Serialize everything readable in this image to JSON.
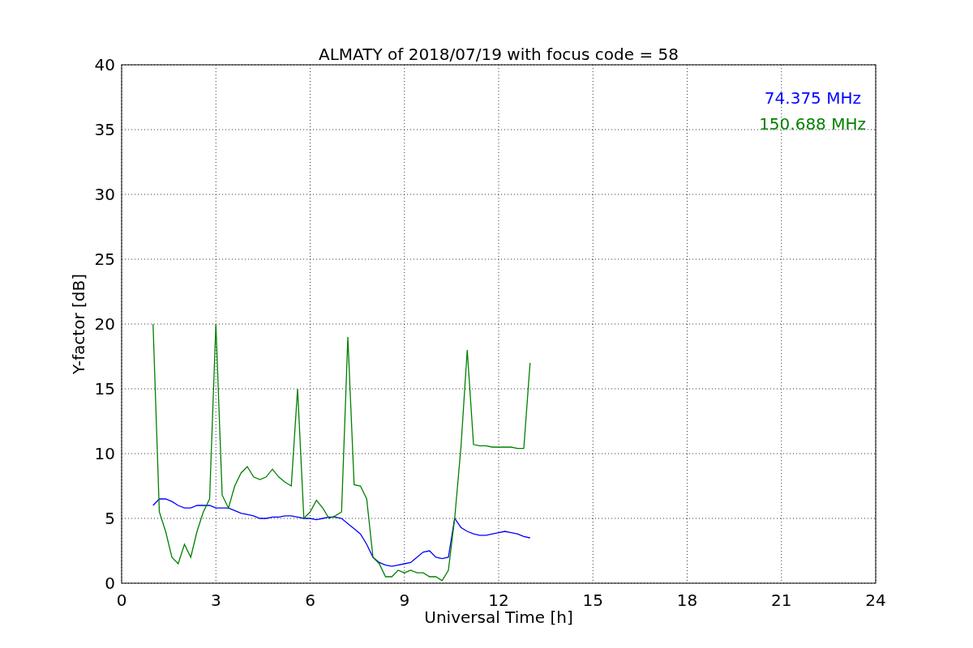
{
  "chart": {
    "chart_data": {
      "type": "line",
      "title": "ALMATY of 2018/07/19 with focus code = 58",
      "xlabel": "Universal Time [h]",
      "ylabel": "Y-factor [dB]",
      "x": [
        1.0,
        1.2,
        1.4,
        1.6,
        1.8,
        2.0,
        2.2,
        2.4,
        2.6,
        2.8,
        3.0,
        3.2,
        3.4,
        3.6,
        3.8,
        4.0,
        4.2,
        4.4,
        4.6,
        4.8,
        5.0,
        5.2,
        5.4,
        5.6,
        5.8,
        6.0,
        6.2,
        6.4,
        6.6,
        6.8,
        7.0,
        7.2,
        7.4,
        7.6,
        7.8,
        8.0,
        8.2,
        8.4,
        8.6,
        8.8,
        9.0,
        9.2,
        9.4,
        9.6,
        9.8,
        10.0,
        10.2,
        10.4,
        10.6,
        10.8,
        11.0,
        11.2,
        11.4,
        11.6,
        11.8,
        12.0,
        12.2,
        12.4,
        12.6,
        12.8,
        13.0
      ],
      "series": [
        {
          "name": "74.375 MHz",
          "color": "#0000ff",
          "values": [
            6.0,
            6.5,
            6.5,
            6.3,
            6.0,
            5.8,
            5.8,
            6.0,
            6.0,
            6.0,
            5.8,
            5.8,
            5.8,
            5.6,
            5.4,
            5.3,
            5.2,
            5.0,
            5.0,
            5.1,
            5.1,
            5.2,
            5.2,
            5.1,
            5.0,
            5.0,
            4.9,
            5.0,
            5.1,
            5.1,
            5.0,
            4.6,
            4.2,
            3.8,
            3.0,
            2.0,
            1.6,
            1.4,
            1.3,
            1.4,
            1.5,
            1.6,
            2.0,
            2.4,
            2.5,
            2.0,
            1.9,
            2.0,
            5.0,
            4.3,
            4.0,
            3.8,
            3.7,
            3.7,
            3.8,
            3.9,
            4.0,
            3.9,
            3.8,
            3.6,
            3.5
          ]
        },
        {
          "name": "150.688 MHz",
          "color": "#008000",
          "values": [
            20.0,
            5.5,
            4.0,
            2.0,
            1.5,
            3.0,
            2.0,
            4.0,
            5.5,
            6.5,
            20.0,
            6.8,
            5.8,
            7.5,
            8.5,
            9.0,
            8.2,
            8.0,
            8.2,
            8.8,
            8.2,
            7.8,
            7.5,
            15.0,
            5.0,
            5.5,
            6.4,
            5.8,
            5.0,
            5.2,
            5.5,
            19.0,
            7.6,
            7.5,
            6.5,
            2.0,
            1.5,
            0.5,
            0.5,
            1.0,
            0.8,
            1.0,
            0.8,
            0.8,
            0.5,
            0.5,
            0.2,
            1.0,
            5.0,
            10.5,
            18.0,
            10.7,
            10.6,
            10.6,
            10.5,
            10.5,
            10.5,
            10.5,
            10.4,
            10.4,
            17.0
          ]
        }
      ],
      "xlim": [
        0,
        24
      ],
      "ylim": [
        0,
        40
      ],
      "xticks": [
        0,
        3,
        6,
        9,
        12,
        15,
        18,
        21,
        24
      ],
      "yticks": [
        0,
        5,
        10,
        15,
        20,
        25,
        30,
        35,
        40
      ],
      "grid": true
    }
  }
}
